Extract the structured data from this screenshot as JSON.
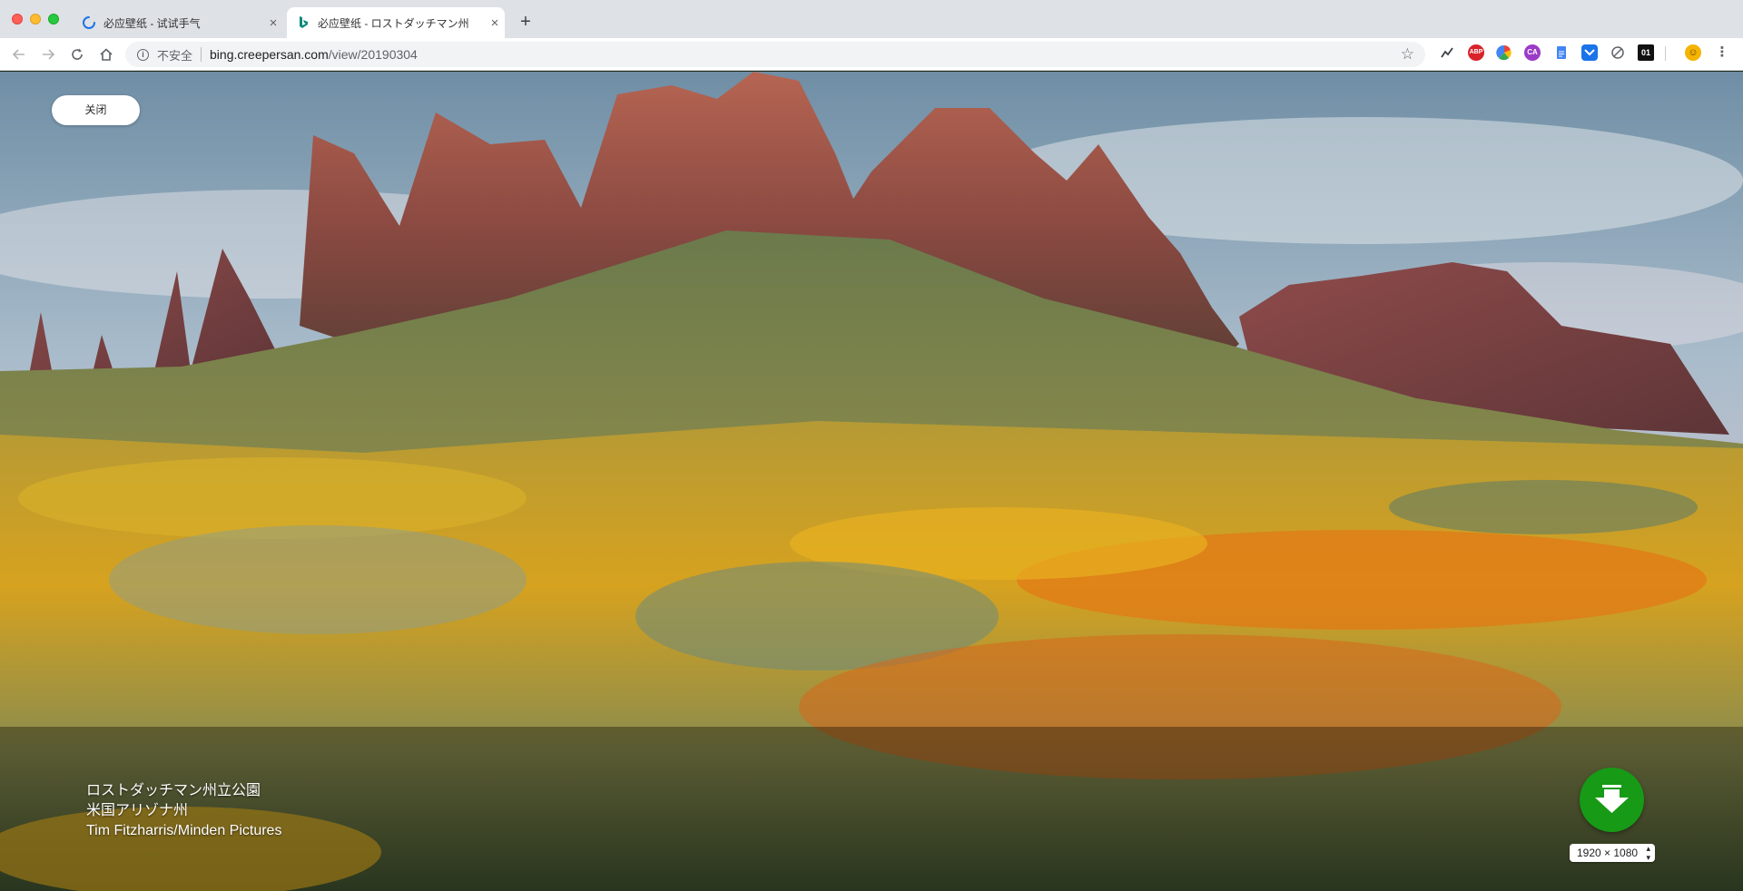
{
  "browser": {
    "tabs": [
      {
        "title": "必应壁纸 - 试试手气",
        "close": "×",
        "active": false
      },
      {
        "title": "必应壁纸 - ロストダッチマン州",
        "close": "×",
        "active": true
      }
    ],
    "new_tab": "+",
    "security_label": "不安全",
    "url_host": "bing.creepersan.com",
    "url_path": "/view/20190304",
    "extensions": [
      "ABP",
      "01"
    ]
  },
  "page": {
    "close_label": "关闭",
    "caption": {
      "title": "ロストダッチマン州立公園",
      "location": "米国アリゾナ州",
      "credit": "Tim Fitzharris/Minden Pictures"
    },
    "resolution_options": [
      "1920 × 1080"
    ],
    "resolution_selected": "1920 × 1080"
  },
  "colors": {
    "download_button": "#179a16",
    "tab_strip": "#dee1e6"
  }
}
